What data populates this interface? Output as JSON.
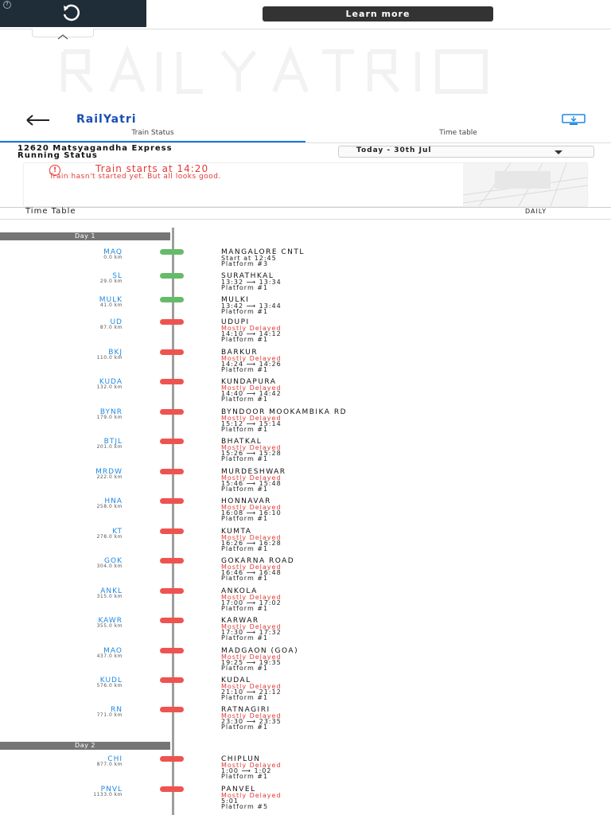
{
  "ad": {
    "info_icon": "info-icon",
    "replay_icon": "replay-icon",
    "learn_more": "Learn more"
  },
  "header": {
    "brand": "RailYatri",
    "back_icon": "back-arrow-icon",
    "share_icon": "screen-icon"
  },
  "tabs": [
    {
      "label": "Train Status"
    },
    {
      "label": "Time table"
    }
  ],
  "train": {
    "name": "12620 Matsyagandha Express",
    "sub": "Running Status",
    "date": "Today - 30th Jul"
  },
  "alert": {
    "title": "Train starts at 14:20",
    "message": "Train hasn't started yet. But all looks good."
  },
  "timetable": {
    "title": "Time Table",
    "frequency": "DAILY"
  },
  "days": [
    {
      "label": "Day 1"
    },
    {
      "label": "Day 2"
    }
  ],
  "stations": [
    {
      "code": "MAQ",
      "km": "0.0 km",
      "name": "MANGALORE CNTL",
      "status": "",
      "time": "Start at 12:45",
      "platform": "Platform #3",
      "dot": "green"
    },
    {
      "code": "SL",
      "km": "29.0 km",
      "name": "SURATHKAL",
      "status": "",
      "time": "13:32 ⟶ 13:34",
      "platform": "Platform #1",
      "dot": "green"
    },
    {
      "code": "MULK",
      "km": "41.0 km",
      "name": "MULKI",
      "status": "",
      "time": "13:42 ⟶ 13:44",
      "platform": "Platform #1",
      "dot": "green"
    },
    {
      "code": "UD",
      "km": "87.0 km",
      "name": "UDUPI",
      "status": "Mostly Delayed",
      "time": "14:10 ⟶ 14:12",
      "platform": "Platform #1",
      "dot": "red"
    },
    {
      "code": "BKJ",
      "km": "110.0 km",
      "name": "BARKUR",
      "status": "Mostly Delayed",
      "time": "14:24 ⟶ 14:26",
      "platform": "Platform #1",
      "dot": "red"
    },
    {
      "code": "KUDA",
      "km": "132.0 km",
      "name": "KUNDAPURA",
      "status": "Mostly Delayed",
      "time": "14:40 ⟶ 14:42",
      "platform": "Platform #1",
      "dot": "red"
    },
    {
      "code": "BYNR",
      "km": "179.0 km",
      "name": "BYNDOOR MOOKAMBIKA RD",
      "status": "Mostly Delayed",
      "time": "15:12 ⟶ 15:14",
      "platform": "Platform #1",
      "dot": "red"
    },
    {
      "code": "BTJL",
      "km": "201.0 km",
      "name": "BHATKAL",
      "status": "Mostly Delayed",
      "time": "15:26 ⟶ 15:28",
      "platform": "Platform #1",
      "dot": "red"
    },
    {
      "code": "MRDW",
      "km": "222.0 km",
      "name": "MURDESHWAR",
      "status": "Mostly Delayed",
      "time": "15:46 ⟶ 15:48",
      "platform": "Platform #1",
      "dot": "red"
    },
    {
      "code": "HNA",
      "km": "258.0 km",
      "name": "HONNAVAR",
      "status": "Mostly Delayed",
      "time": "16:08 ⟶ 16:10",
      "platform": "Platform #1",
      "dot": "red"
    },
    {
      "code": "KT",
      "km": "278.0 km",
      "name": "KUMTA",
      "status": "Mostly Delayed",
      "time": "16:26 ⟶ 16:28",
      "platform": "Platform #1",
      "dot": "red"
    },
    {
      "code": "GOK",
      "km": "304.0 km",
      "name": "GOKARNA ROAD",
      "status": "Mostly Delayed",
      "time": "16:46 ⟶ 16:48",
      "platform": "Platform #1",
      "dot": "red"
    },
    {
      "code": "ANKL",
      "km": "315.0 km",
      "name": "ANKOLA",
      "status": "Mostly Delayed",
      "time": "17:00 ⟶ 17:02",
      "platform": "Platform #1",
      "dot": "red"
    },
    {
      "code": "KAWR",
      "km": "355.0 km",
      "name": "KARWAR",
      "status": "Mostly Delayed",
      "time": "17:30 ⟶ 17:32",
      "platform": "Platform #1",
      "dot": "red"
    },
    {
      "code": "MAO",
      "km": "437.0 km",
      "name": "MADGAON (GOA)",
      "status": "Mostly Delayed",
      "time": "19:25 ⟶ 19:35",
      "platform": "Platform #1",
      "dot": "red"
    },
    {
      "code": "KUDL",
      "km": "576.0 km",
      "name": "KUDAL",
      "status": "Mostly Delayed",
      "time": "21:10 ⟶ 21:12",
      "platform": "Platform #1",
      "dot": "red"
    },
    {
      "code": "RN",
      "km": "771.0 km",
      "name": "RATNAGIRI",
      "status": "Mostly Delayed",
      "time": "23:30 ⟶ 23:35",
      "platform": "Platform #1",
      "dot": "red"
    },
    {
      "code": "CHI",
      "km": "877.0 km",
      "name": "CHIPLUN",
      "status": "Mostly Delayed",
      "time": "1:00 ⟶ 1:02",
      "platform": "Platform #1",
      "dot": "red"
    },
    {
      "code": "PNVL",
      "km": "1133.0 km",
      "name": "PANVEL",
      "status": "Mostly Delayed",
      "time": "5:01",
      "platform": "Platform #5",
      "dot": "red"
    }
  ]
}
